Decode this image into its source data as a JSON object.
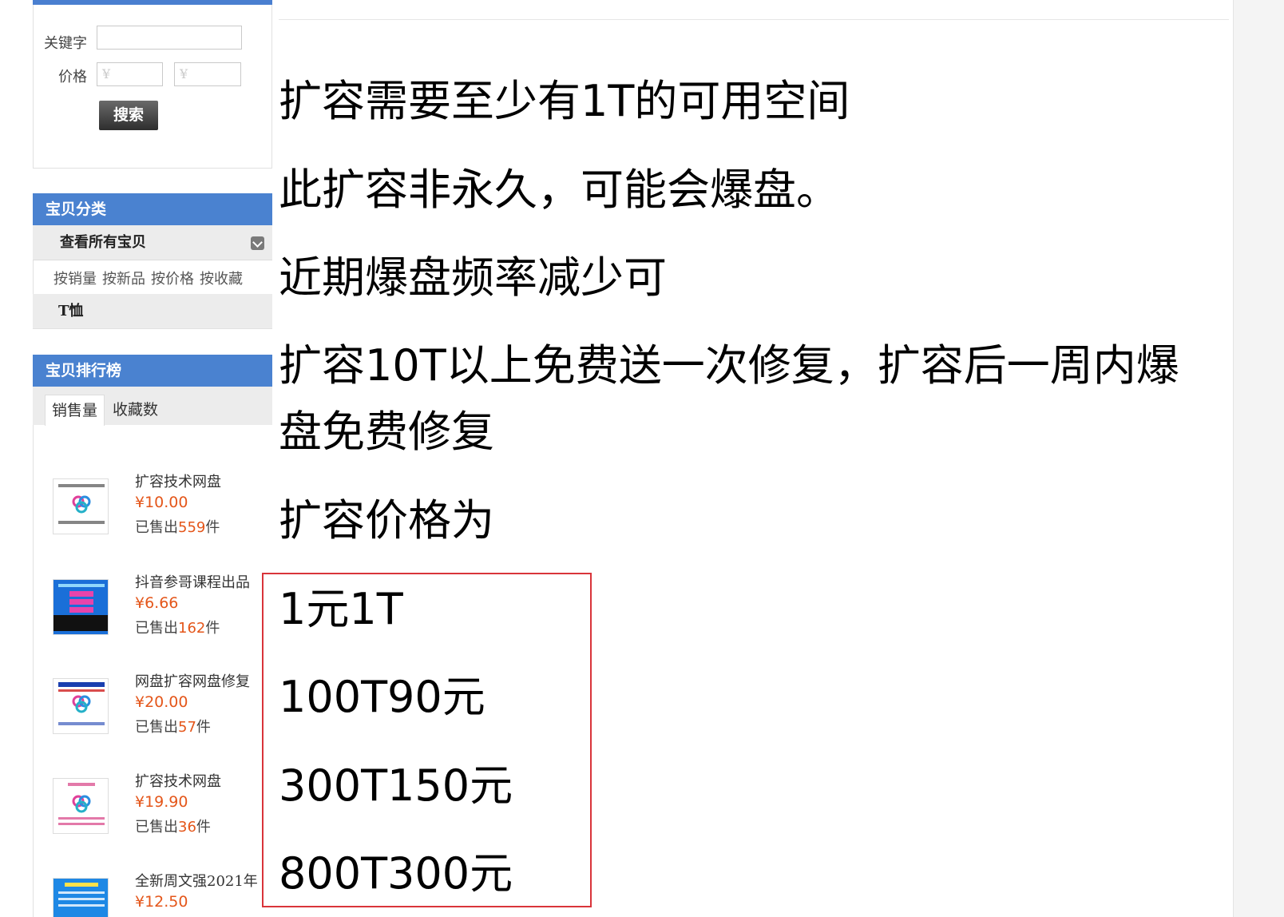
{
  "search": {
    "keyword_label": "关键字",
    "keyword_value": "",
    "price_label": "价格",
    "price_min_placeholder": "¥",
    "price_max_placeholder": "¥",
    "button_label": "搜索"
  },
  "categories": {
    "title": "宝贝分类",
    "all_label": "查看所有宝贝",
    "sort_links": [
      "按销量",
      "按新品",
      "按价格",
      "按收藏"
    ],
    "items": [
      "T恤"
    ]
  },
  "ranking": {
    "title": "宝贝排行榜",
    "tabs": [
      "销售量",
      "收藏数"
    ],
    "sold_prefix": "已售出",
    "sold_suffix": "件",
    "items": [
      {
        "title": "扩容技术网盘",
        "price": "¥10.00",
        "sold": "559"
      },
      {
        "title": "抖音参哥课程出品",
        "price": "¥6.66",
        "sold": "162"
      },
      {
        "title": "网盘扩容网盘修复",
        "price": "¥20.00",
        "sold": "57"
      },
      {
        "title": "扩容技术网盘",
        "price": "¥19.90",
        "sold": "36"
      },
      {
        "title": "全新周文强2021年",
        "price": "¥12.50",
        "sold": ""
      }
    ]
  },
  "content": {
    "lines": [
      "扩容需要至少有1T的可用空间",
      "此扩容非永久，可能会爆盘。",
      "近期爆盘频率减少可",
      "扩容10T以上免费送一次修复，扩容后一周内爆",
      "盘免费修复",
      "扩容价格为"
    ],
    "prices": [
      "1元1T",
      "100T90元",
      "300T150元",
      "800T300元"
    ]
  },
  "colors": {
    "header_blue": "#4a82d0",
    "price_orange": "#e4561a",
    "box_red": "#d9343a"
  }
}
